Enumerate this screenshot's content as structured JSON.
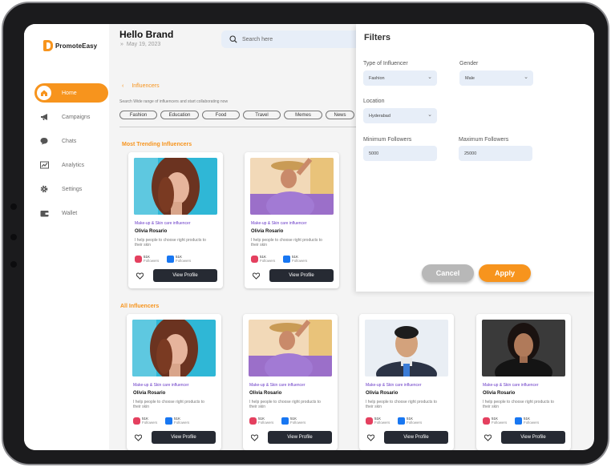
{
  "brand": "PromoteEasy",
  "header": {
    "greeting": "Hello Brand",
    "date": "May 19, 2023"
  },
  "search": {
    "placeholder": "Search here"
  },
  "sidebar": {
    "items": [
      {
        "label": "Home",
        "icon": "home-icon",
        "active": true
      },
      {
        "label": "Campaigns",
        "icon": "megaphone-icon"
      },
      {
        "label": "Chats",
        "icon": "chat-icon"
      },
      {
        "label": "Analytics",
        "icon": "chart-icon"
      },
      {
        "label": "Settings",
        "icon": "gear-icon"
      },
      {
        "label": "Wallet",
        "icon": "wallet-icon"
      }
    ]
  },
  "page": {
    "back_label": "Influencers",
    "subtitle": "Search Wide range of influencers and start collaborating now",
    "categories": [
      "Fashion",
      "Education",
      "Food",
      "Travel",
      "Memes",
      "News"
    ],
    "trending_title": "Most Trending Influencers",
    "all_title": "All Influencers"
  },
  "card": {
    "category": "Make-up & Skin care influencer",
    "name": "Olivia Rosario",
    "description": "I help people to choose right products to their skin",
    "ig_count": "51K",
    "fb_count": "51K",
    "followers_label": "Followers",
    "view_label": "View Profile"
  },
  "filters": {
    "title": "Filters",
    "type_label": "Type of Influencer",
    "type_value": "Fashion",
    "gender_label": "Gender",
    "gender_value": "Male",
    "location_label": "Location",
    "location_value": "Hyderabad",
    "min_label": "Minimum Followers",
    "min_value": "5000",
    "max_label": "Maximum Followers",
    "max_value": "25000",
    "cancel_label": "Cancel",
    "apply_label": "Apply"
  },
  "colors": {
    "accent": "#f7941d",
    "dark_button": "#262a33",
    "tag": "#6a3bc7"
  }
}
